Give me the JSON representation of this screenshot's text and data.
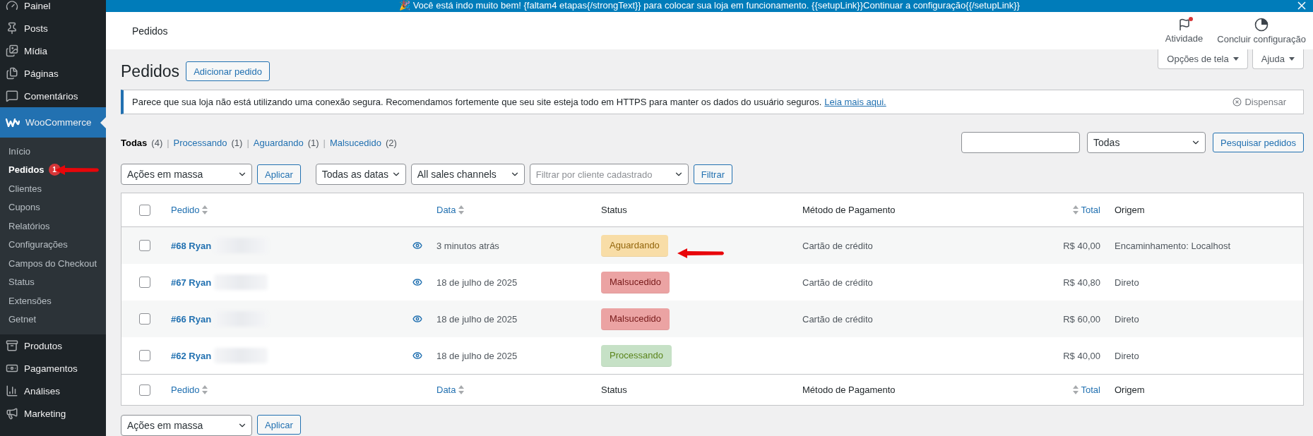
{
  "notice_bar": {
    "text": "🎉 Você está indo muito bem! {faltam4 etapas{/strongText}} para colocar sua loja em funcionamento. {{setupLink}}Continuar a configuração{{/setupLink}}"
  },
  "sidebar": {
    "items": [
      {
        "label": "Painel",
        "selected": false
      },
      {
        "label": "Posts",
        "selected": false
      },
      {
        "label": "Mídia",
        "selected": false
      },
      {
        "label": "Páginas",
        "selected": false
      },
      {
        "label": "Comentários",
        "selected": false
      },
      {
        "label": "WooCommerce",
        "selected": true,
        "children": [
          {
            "label": "Início",
            "selected": false,
            "annotated": false
          },
          {
            "label": "Pedidos",
            "selected": true,
            "badge": "1",
            "annotated": true
          },
          {
            "label": "Clientes",
            "selected": false,
            "annotated": false
          },
          {
            "label": "Cupons",
            "selected": false,
            "annotated": false
          },
          {
            "label": "Relatórios",
            "selected": false,
            "annotated": false
          },
          {
            "label": "Configurações",
            "selected": false,
            "annotated": false
          },
          {
            "label": "Campos do Checkout",
            "selected": false,
            "annotated": false
          },
          {
            "label": "Status",
            "selected": false,
            "annotated": false
          },
          {
            "label": "Extensões",
            "selected": false,
            "annotated": false
          },
          {
            "label": "Getnet",
            "selected": false,
            "annotated": false
          }
        ]
      },
      {
        "label": "Produtos",
        "selected": false
      },
      {
        "label": "Pagamentos",
        "selected": false
      },
      {
        "label": "Análises",
        "selected": false
      },
      {
        "label": "Marketing",
        "selected": false
      }
    ]
  },
  "header": {
    "title": "Pedidos",
    "actions": [
      {
        "label": "Atividade",
        "alert": true
      },
      {
        "label": "Concluir configuração",
        "alert": false
      }
    ]
  },
  "screen_tabs": [
    "Opções de tela",
    "Ajuda"
  ],
  "page": {
    "title": "Pedidos",
    "add_button": "Adicionar pedido"
  },
  "notice": {
    "text": "Parece que sua loja não está utilizando uma conexão segura. Recomendamos fortemente que seu site esteja todo em HTTPS para manter os dados do usuário seguros.",
    "link": "Leia mais aqui.",
    "dismiss": "Dispensar"
  },
  "views": [
    {
      "label": "Todas",
      "count": "(4)",
      "selected": true
    },
    {
      "separator": "|",
      "label": "Processando",
      "count": "(1)",
      "selected": false
    },
    {
      "separator": "|",
      "label": "Aguardando",
      "count": "(1)",
      "selected": false
    },
    {
      "separator": "|",
      "label": "Malsucedido",
      "count": "(2)",
      "selected": false
    }
  ],
  "search": {
    "status_select": "Todas",
    "button": "Pesquisar pedidos"
  },
  "filters": {
    "bulk_actions": "Ações em massa",
    "apply": "Aplicar",
    "dates": "Todas as datas",
    "channels": "All sales channels",
    "customer_placeholder": "Filtrar por cliente cadastrado",
    "filter_button": "Filtrar"
  },
  "table": {
    "header_checked": false,
    "footer_checked": false,
    "columns": [
      {
        "label": "Pedido",
        "sortable": true
      },
      {
        "label": "Data",
        "sortable": true
      },
      {
        "label": "Status",
        "sortable": false
      },
      {
        "label": "Método de Pagamento",
        "sortable": false
      },
      {
        "label": "Total",
        "sortable": true
      },
      {
        "label": "Origem",
        "sortable": false
      }
    ],
    "rows": [
      {
        "order": "#68 Ryan",
        "date": "3 minutos atrás",
        "status": {
          "label": "Aguardando",
          "kind": "on-hold"
        },
        "payment": "Cartão de crédito",
        "total": "R$ 40,00",
        "origin": "Encaminhamento: Localhost",
        "checked": false,
        "annotated": true
      },
      {
        "order": "#67 Ryan",
        "date": "18 de julho de 2025",
        "status": {
          "label": "Malsucedido",
          "kind": "failed"
        },
        "payment": "Cartão de crédito",
        "total": "R$ 40,80",
        "origin": "Direto",
        "checked": false,
        "annotated": false
      },
      {
        "order": "#66 Ryan",
        "date": "18 de julho de 2025",
        "status": {
          "label": "Malsucedido",
          "kind": "failed"
        },
        "payment": "Cartão de crédito",
        "total": "R$ 60,00",
        "origin": "Direto",
        "checked": false,
        "annotated": false
      },
      {
        "order": "#62 Ryan",
        "date": "18 de julho de 2025",
        "status": {
          "label": "Processando",
          "kind": "processing"
        },
        "total": "R$ 40,00",
        "origin": "Direto",
        "checked": false,
        "annotated": false
      }
    ],
    "footer_columns": [
      {
        "label": "Pedido",
        "sortable": true
      },
      {
        "label": "Data",
        "sortable": true
      },
      {
        "label": "Status",
        "sortable": false
      },
      {
        "label": "Método de Pagamento",
        "sortable": false
      },
      {
        "label": "Total",
        "sortable": true
      },
      {
        "label": "Origem",
        "sortable": false
      }
    ]
  },
  "bottom_actions": {
    "bulk_actions": "Ações em massa",
    "apply": "Aplicar"
  }
}
